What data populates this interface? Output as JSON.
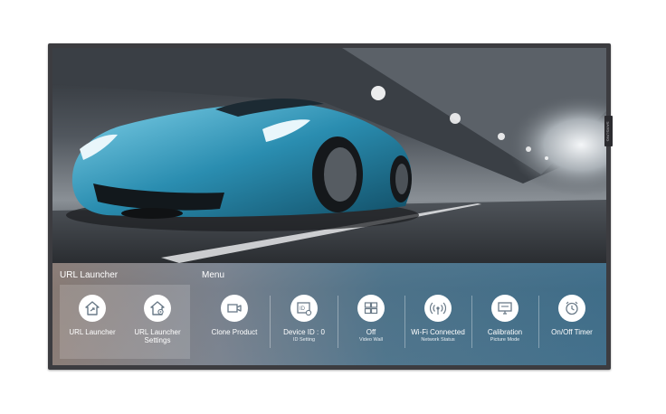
{
  "brand": {
    "logo_text": "SAMSUNG"
  },
  "menu": {
    "url_launcher_section": "URL Launcher",
    "menu_section": "Menu",
    "tiles": [
      {
        "label": "URL Launcher",
        "sub": "",
        "icon": "url-launcher-icon"
      },
      {
        "label": "URL Launcher\nSettings",
        "sub": "",
        "icon": "home-settings-icon"
      },
      {
        "label": "Clone Product",
        "sub": "",
        "icon": "clone-product-icon"
      },
      {
        "label": "Device ID : 0",
        "sub": "ID Setting",
        "icon": "id-setting-icon"
      },
      {
        "label": "Off",
        "sub": "Video Wall",
        "icon": "video-wall-icon"
      },
      {
        "label": "Wi-Fi Connected",
        "sub": "Network Status",
        "icon": "network-icon"
      },
      {
        "label": "Calibration",
        "sub": "Picture Mode",
        "icon": "picture-mode-icon"
      },
      {
        "label": "On/Off Timer",
        "sub": "",
        "icon": "clock-icon"
      }
    ]
  },
  "colors": {
    "icon_color": "#6a7a88",
    "bezel": "#3c3c40",
    "text": "#ffffff"
  }
}
